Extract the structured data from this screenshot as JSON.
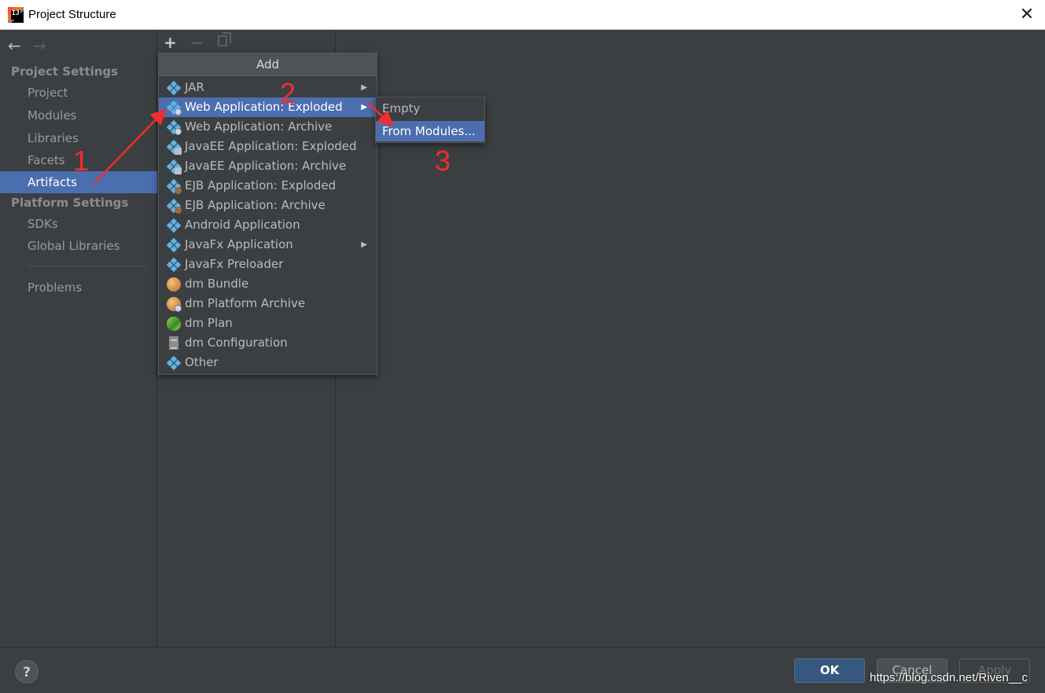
{
  "window": {
    "title": "Project Structure",
    "close_glyph": "✕"
  },
  "nav": {
    "back": "←",
    "forward": "→"
  },
  "sidebar": {
    "project_settings_header": "Project Settings",
    "project_items": [
      "Project",
      "Modules",
      "Libraries",
      "Facets",
      "Artifacts"
    ],
    "selected_item": "Artifacts",
    "platform_settings_header": "Platform Settings",
    "platform_items": [
      "SDKs",
      "Global Libraries"
    ],
    "problems": "Problems"
  },
  "toolbar": {
    "add": "+",
    "remove": "−"
  },
  "add_menu": {
    "title": "Add",
    "items": [
      {
        "label": "JAR",
        "icon": "artifact-icon",
        "has_submenu": true
      },
      {
        "label": "Web Application: Exploded",
        "icon": "web-artifact-icon",
        "has_submenu": true,
        "selected": true
      },
      {
        "label": "Web Application: Archive",
        "icon": "web-artifact-icon"
      },
      {
        "label": "JavaEE Application: Exploded",
        "icon": "javaee-artifact-icon"
      },
      {
        "label": "JavaEE Application: Archive",
        "icon": "javaee-artifact-icon"
      },
      {
        "label": "EJB Application: Exploded",
        "icon": "ejb-artifact-icon"
      },
      {
        "label": "EJB Application: Archive",
        "icon": "ejb-artifact-icon"
      },
      {
        "label": "Android Application",
        "icon": "artifact-icon"
      },
      {
        "label": "JavaFx Application",
        "icon": "artifact-icon",
        "has_submenu": true
      },
      {
        "label": "JavaFx Preloader",
        "icon": "artifact-icon"
      },
      {
        "label": "dm Bundle",
        "icon": "dm-bundle-icon"
      },
      {
        "label": "dm Platform Archive",
        "icon": "dm-platform-icon"
      },
      {
        "label": "dm Plan",
        "icon": "dm-plan-icon"
      },
      {
        "label": "dm Configuration",
        "icon": "dm-config-icon"
      },
      {
        "label": "Other",
        "icon": "artifact-icon"
      }
    ],
    "submenu_arrow": "▶"
  },
  "submenu": {
    "items": [
      "Empty",
      "From Modules..."
    ],
    "selected": "From Modules..."
  },
  "annotations": {
    "one": "1",
    "two": "2",
    "three": "3",
    "color": "#ee2e2e"
  },
  "footer": {
    "help": "?",
    "ok": "OK",
    "cancel": "Cancel",
    "apply": "Apply",
    "watermark": "https://blog.csdn.net/Riven__c"
  },
  "colors": {
    "selection": "#4b6eaf",
    "background": "#3c3f41",
    "ok_button": "#365880"
  }
}
